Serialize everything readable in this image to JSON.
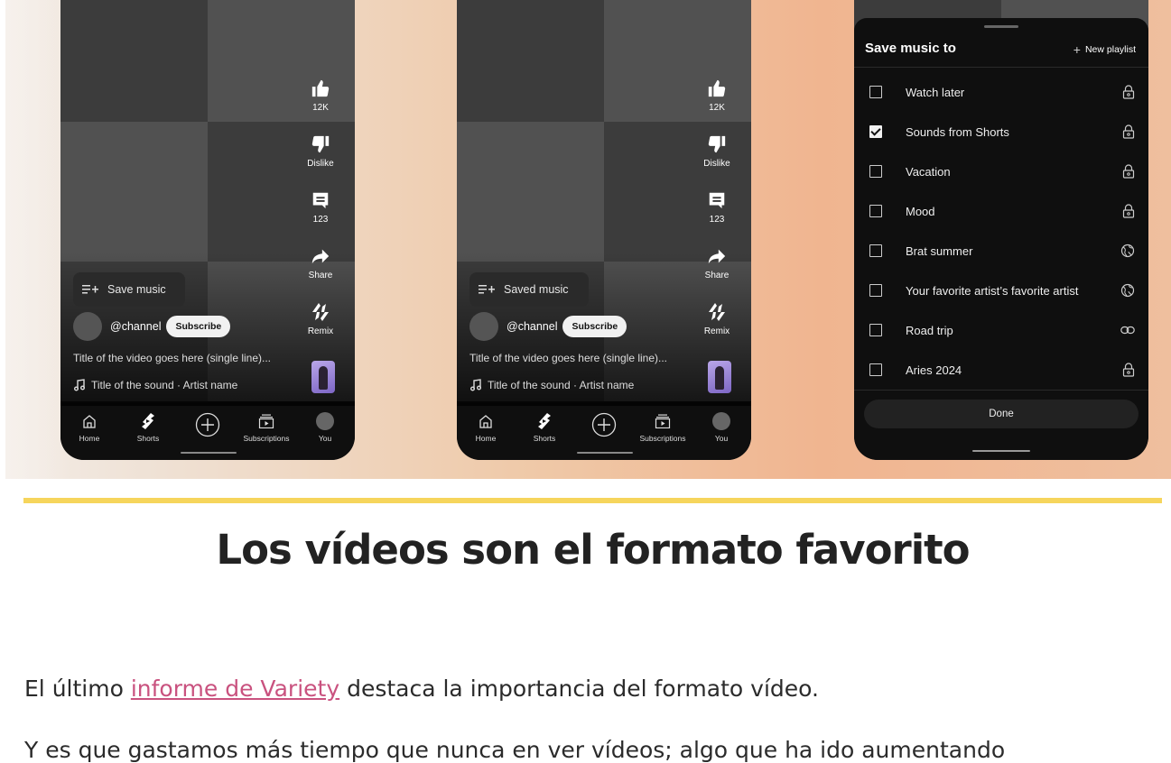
{
  "phones": [
    {
      "actions": {
        "like_count": "12K",
        "dislike_label": "Dislike",
        "comment_count": "123",
        "share_label": "Share",
        "remix_label": "Remix"
      },
      "save_button_label": "Save music",
      "channel": "@channel",
      "subscribe_label": "Subscribe",
      "video_title": "Title of the video goes here (single line)...",
      "sound_line": "Title of the sound · Artist name",
      "nav": {
        "home": "Home",
        "shorts": "Shorts",
        "subscriptions": "Subscriptions",
        "you": "You"
      }
    },
    {
      "actions": {
        "like_count": "12K",
        "dislike_label": "Dislike",
        "comment_count": "123",
        "share_label": "Share",
        "remix_label": "Remix"
      },
      "save_button_label": "Saved music",
      "channel": "@channel",
      "subscribe_label": "Subscribe",
      "video_title": "Title of the video goes here (single line)...",
      "sound_line": "Title of the sound · Artist name",
      "nav": {
        "home": "Home",
        "shorts": "Shorts",
        "subscriptions": "Subscriptions",
        "you": "You"
      }
    }
  ],
  "save_sheet": {
    "title": "Save music to",
    "new_playlist": "New playlist",
    "items": [
      {
        "label": "Watch later",
        "checked": false,
        "icon": "lock-icon"
      },
      {
        "label": "Sounds from Shorts",
        "checked": true,
        "icon": "lock-icon"
      },
      {
        "label": "Vacation",
        "checked": false,
        "icon": "lock-icon"
      },
      {
        "label": "Mood",
        "checked": false,
        "icon": "lock-icon"
      },
      {
        "label": "Brat summer",
        "checked": false,
        "icon": "globe-icon"
      },
      {
        "label": "Your favorite artist’s favorite artist",
        "checked": false,
        "icon": "globe-icon"
      },
      {
        "label": "Road trip",
        "checked": false,
        "icon": "link-icon"
      },
      {
        "label": "Aries 2024",
        "checked": false,
        "icon": "lock-icon"
      }
    ],
    "done_label": "Done"
  },
  "article": {
    "heading": "Los vídeos son el formato favorito",
    "para1_before": "El último ",
    "para1_link": "informe de Variety",
    "para1_after": " destaca la importancia del formato vídeo.",
    "para2": "Y es que gastamos más tiempo que nunca en ver vídeos; algo que ha ido aumentando"
  },
  "colors": {
    "accent_yellow": "#f6d55c",
    "link_pink": "#c9527f"
  }
}
